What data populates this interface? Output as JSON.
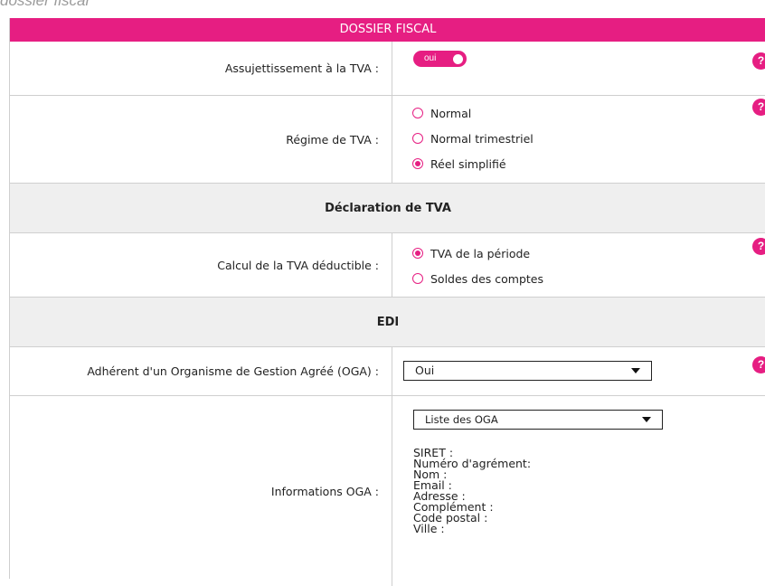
{
  "caption": "dossier fiscal",
  "section_title": "DOSSIER FISCAL",
  "help_glyph": "?",
  "assujettissement": {
    "label": "Assujettissement à la TVA :",
    "toggle_text": "oui"
  },
  "regime": {
    "label": "Régime de TVA :",
    "options": [
      "Normal",
      "Normal trimestriel",
      "Réel simplifié"
    ],
    "selected": "Réel simplifié"
  },
  "declaration_section": "Déclaration de TVA",
  "calcul": {
    "label": "Calcul de la TVA déductible :",
    "options": [
      "TVA de la période",
      "Soldes des comptes"
    ],
    "selected": "TVA de la période"
  },
  "edi_section": "EDI",
  "oga_member": {
    "label": "Adhérent d'un Organisme de Gestion Agréé (OGA) :",
    "value": "Oui"
  },
  "oga_info": {
    "label": "Informations OGA :",
    "select_value": "Liste des OGA",
    "fields": [
      "SIRET :",
      "Numéro d'agrément:",
      "Nom :",
      "Email :",
      "Adresse :",
      "Complément :",
      "Code postal :",
      "Ville :"
    ]
  },
  "colors": {
    "accent": "#e61e82",
    "section_bg": "#efefef",
    "border": "#cfcfcf"
  }
}
